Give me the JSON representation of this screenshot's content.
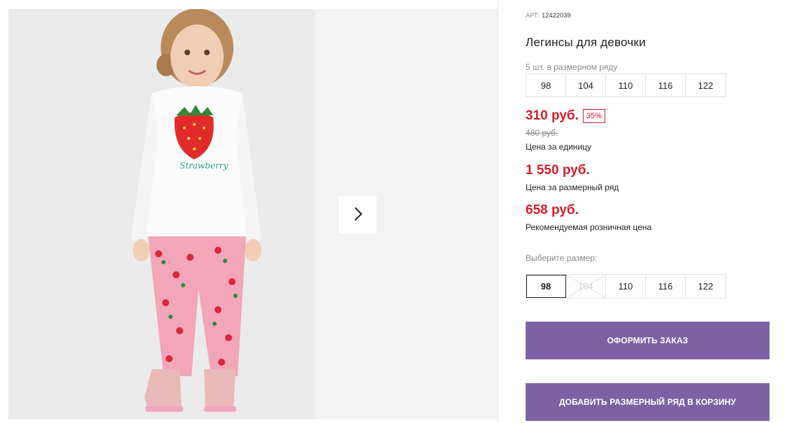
{
  "product": {
    "art_label": "АРТ:",
    "art_number": "12422039",
    "title": "Легинсы для девочки",
    "row_count": "5 шт. в размерном ряду",
    "row_sizes": [
      "98",
      "104",
      "110",
      "116",
      "122"
    ]
  },
  "prices": {
    "unit_price": "310 руб.",
    "discount": "35%",
    "old_price": "480 руб.",
    "unit_label": "Цена за единицу",
    "row_price": "1 550 руб.",
    "row_label": "Цена за размерный ряд",
    "retail_price": "658 руб.",
    "retail_label": "Рекомендуемая розничная цена"
  },
  "size_picker": {
    "label": "Выберите размер:",
    "sizes": [
      {
        "label": "98",
        "state": "selected"
      },
      {
        "label": "104",
        "state": "disabled"
      },
      {
        "label": "110",
        "state": "available"
      },
      {
        "label": "116",
        "state": "available"
      },
      {
        "label": "122",
        "state": "available"
      }
    ]
  },
  "actions": {
    "order_label": "ОФОРМИТЬ ЗАКАЗ",
    "add_row_label": "ДОБАВИТЬ РАЗМЕРНЫЙ РЯД В КОРЗИНУ"
  },
  "gallery": {
    "next_icon": "chevron-right-icon",
    "shirt_print": "Strawberry"
  },
  "colors": {
    "accent": "#7b63a3",
    "price_red": "#d31f2b",
    "muted": "#8a8a8a"
  }
}
